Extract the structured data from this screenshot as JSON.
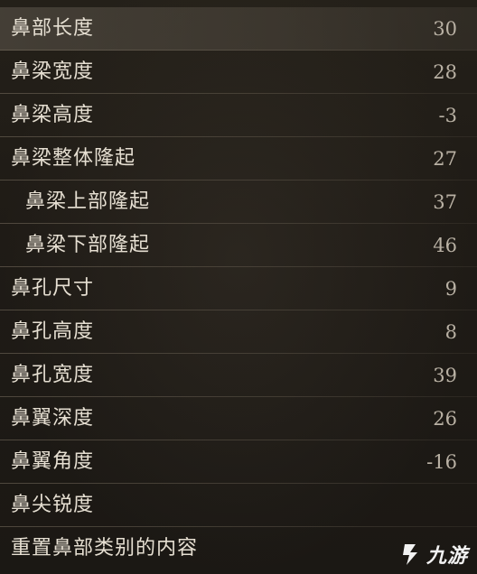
{
  "rows": [
    {
      "label": "鼻部长度",
      "value": "30"
    },
    {
      "label": "鼻梁宽度",
      "value": "28"
    },
    {
      "label": "鼻梁高度",
      "value": "-3"
    },
    {
      "label": "鼻梁整体隆起",
      "value": "27"
    },
    {
      "label": "鼻梁上部隆起",
      "value": "37"
    },
    {
      "label": "鼻梁下部隆起",
      "value": "46"
    },
    {
      "label": "鼻孔尺寸",
      "value": "9"
    },
    {
      "label": "鼻孔高度",
      "value": "8"
    },
    {
      "label": "鼻孔宽度",
      "value": "39"
    },
    {
      "label": "鼻翼深度",
      "value": "26"
    },
    {
      "label": "鼻翼角度",
      "value": "-16"
    },
    {
      "label": "鼻尖锐度",
      "value": ""
    },
    {
      "label": "重置鼻部类别的内容",
      "value": ""
    }
  ],
  "watermark": {
    "text": "九游",
    "icon": "jiuyou-logo-icon"
  },
  "colors": {
    "background": "#1d1a16",
    "selected_row": "#5a5248",
    "text": "#e6dfd2",
    "value_text": "#b9b1a4"
  }
}
